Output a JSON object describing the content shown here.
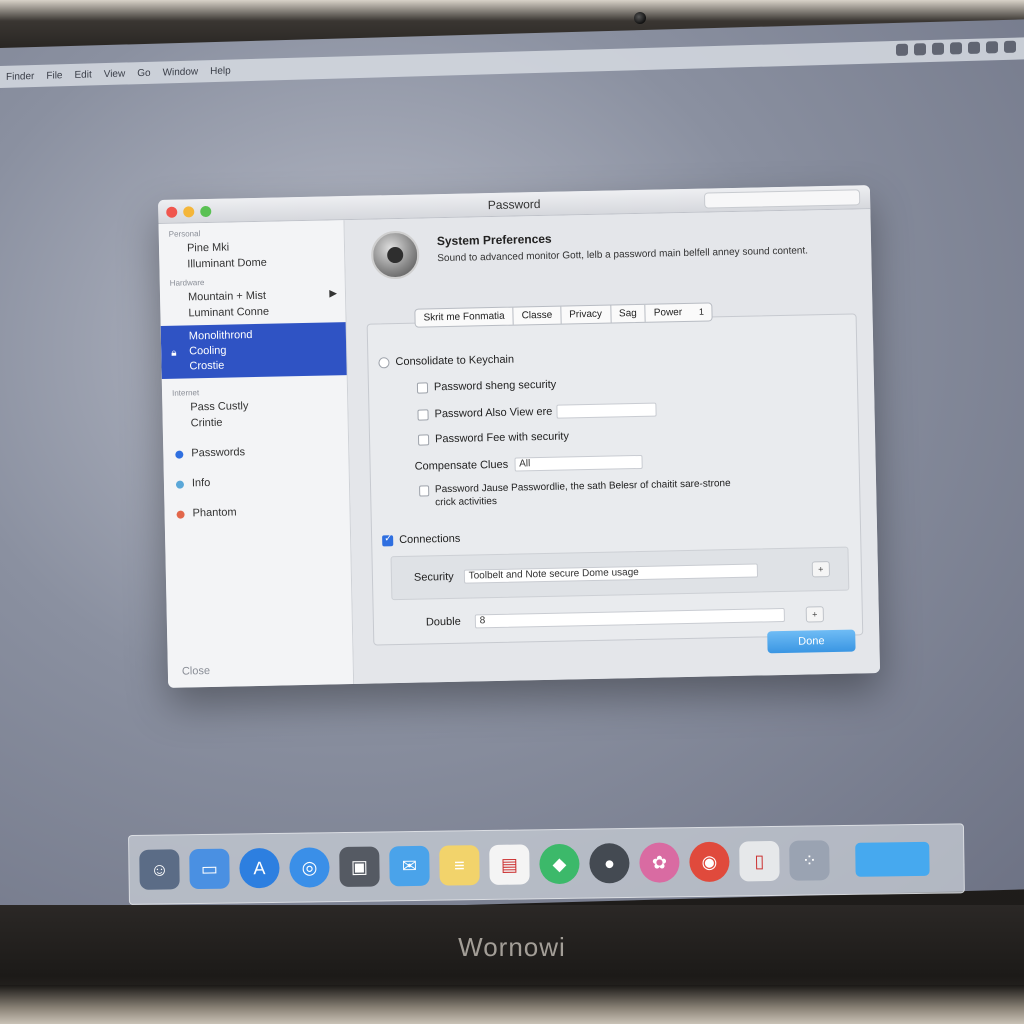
{
  "brand": "Wornowi",
  "menubar": {
    "items": [
      "Finder",
      "File",
      "Edit",
      "View",
      "Go",
      "Window",
      "Help"
    ]
  },
  "window": {
    "title": "Password"
  },
  "sidebar": {
    "section_1": "Personal",
    "items_a": [
      "Pine Mki",
      "Illuminant Dome"
    ],
    "section_2": "Hardware",
    "items_b": [
      "Mountain + Mist",
      "Luminant Conne"
    ],
    "selected_lines": [
      "Monolithrond",
      "Cooling",
      "Crostie"
    ],
    "section_3": "Internet",
    "items_c": [
      "Pass Custly",
      "Crintie"
    ],
    "dotted_items": [
      {
        "label": "Passwords",
        "color": "#2f6fe0"
      },
      {
        "label": "Info",
        "color": "#5aa7d8"
      },
      {
        "label": "Phantom",
        "color": "#e2674b"
      }
    ],
    "footer": "Close"
  },
  "main": {
    "title": "System Preferences",
    "description": "Sound to advanced monitor Gott, lelb a password main belfell anney sound content.",
    "tabs": [
      "Skrit me Fonmatia",
      "Classe",
      "Privacy",
      "Sag",
      "Power"
    ],
    "tab_stepper": "1",
    "radio_label": "Consolidate to Keychain",
    "options": [
      {
        "label": "Password sheng security",
        "field": ""
      },
      {
        "label": "Password Also View ere",
        "field": ""
      },
      {
        "label": "Password Fee with security",
        "field": ""
      }
    ],
    "complement_label": "Compensate Clues",
    "complement_value": "All",
    "long_option": "Password Jause Passwordlie, the sath Belesr of chaitit sare-strone crick activities",
    "checked_label": "Connections",
    "security_label": "Security",
    "security_value": "Toolbelt and Note secure Dome usage",
    "security_stepper": "+",
    "double_label": "Double",
    "double_value": "8",
    "double_stepper": "+",
    "primary_button": "Done"
  },
  "dock": {
    "icons": [
      {
        "name": "finder-icon",
        "color": "#5b6c86",
        "glyph": "☺"
      },
      {
        "name": "preview-icon",
        "color": "#4a90e2",
        "glyph": "▭"
      },
      {
        "name": "appstore-icon",
        "color": "#2d7fe0",
        "glyph": "A"
      },
      {
        "name": "safari-icon",
        "color": "#3a8fe8",
        "glyph": "◎"
      },
      {
        "name": "camera-icon",
        "color": "#555a63",
        "glyph": "▣"
      },
      {
        "name": "mail-icon",
        "color": "#4aa3ea",
        "glyph": "✉"
      },
      {
        "name": "notes-icon",
        "color": "#f2d36b",
        "glyph": "≡"
      },
      {
        "name": "calendar-icon",
        "color": "#f4f4f4",
        "glyph": "▤"
      },
      {
        "name": "maps-icon",
        "color": "#3cb96a",
        "glyph": "◆"
      },
      {
        "name": "facetime-icon",
        "color": "#444a52",
        "glyph": "●"
      },
      {
        "name": "photos-icon",
        "color": "#d96ba2",
        "glyph": "✿"
      },
      {
        "name": "chrome-icon",
        "color": "#e04a3c",
        "glyph": "◉"
      },
      {
        "name": "utility-icon",
        "color": "#e6e8ea",
        "glyph": "▯"
      },
      {
        "name": "launchpad-icon",
        "color": "#9aa3b2",
        "glyph": "⁘"
      },
      {
        "name": "folder-icon",
        "color": "#46a9ef",
        "glyph": ""
      }
    ]
  }
}
